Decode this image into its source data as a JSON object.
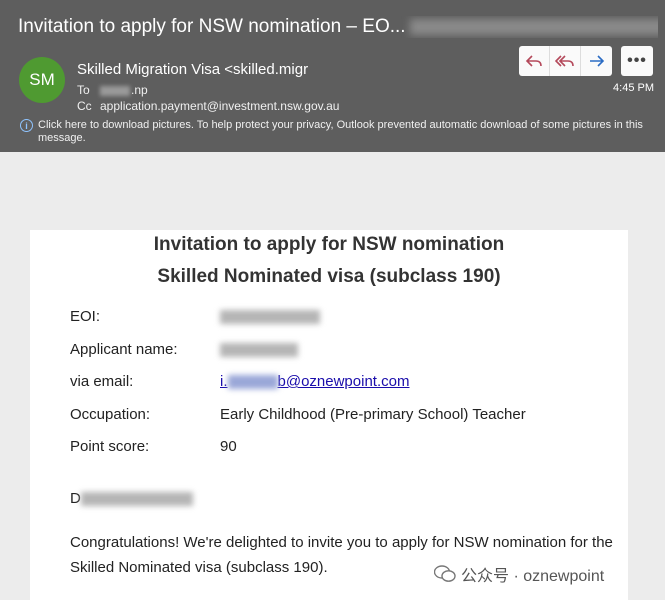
{
  "email": {
    "subject": "Invitation to apply for NSW nomination – EO...",
    "subject_tail": "...",
    "avatar_initials": "SM",
    "sender": "Skilled Migration Visa <skilled.migr",
    "to_label": "To",
    "to_value": ".np",
    "cc_label": "Cc",
    "cc_value": "application.payment@investment.nsw.gov.au",
    "time": "4:45 PM",
    "info_text": "Click here to download pictures. To help protect your privacy, Outlook prevented automatic download of some pictures in this message.",
    "more_label": "•••"
  },
  "body": {
    "title_line1": "Invitation to apply for NSW nomination",
    "title_line2": "Skilled Nominated visa (subclass 190)",
    "fields": {
      "eoi_label": "EOI:",
      "applicant_label": "Applicant name:",
      "email_label": "via email:",
      "email_prefix": "i.",
      "email_suffix": "b@oznewpoint.com",
      "occupation_label": "Occupation:",
      "occupation_value": "Early Childhood (Pre-primary School) Teacher",
      "points_label": "Point score:",
      "points_value": "90"
    },
    "salutation_start": "D",
    "paragraph": "Congratulations! We're delighted to invite you to apply for NSW nomination for the Skilled Nominated visa (subclass 190)."
  },
  "watermark": {
    "footer": "公众号 · oznewpoint"
  },
  "colors": {
    "header_bg": "#5e5e5e",
    "avatar_bg": "#4f9a31",
    "link": "#1a0dab"
  }
}
